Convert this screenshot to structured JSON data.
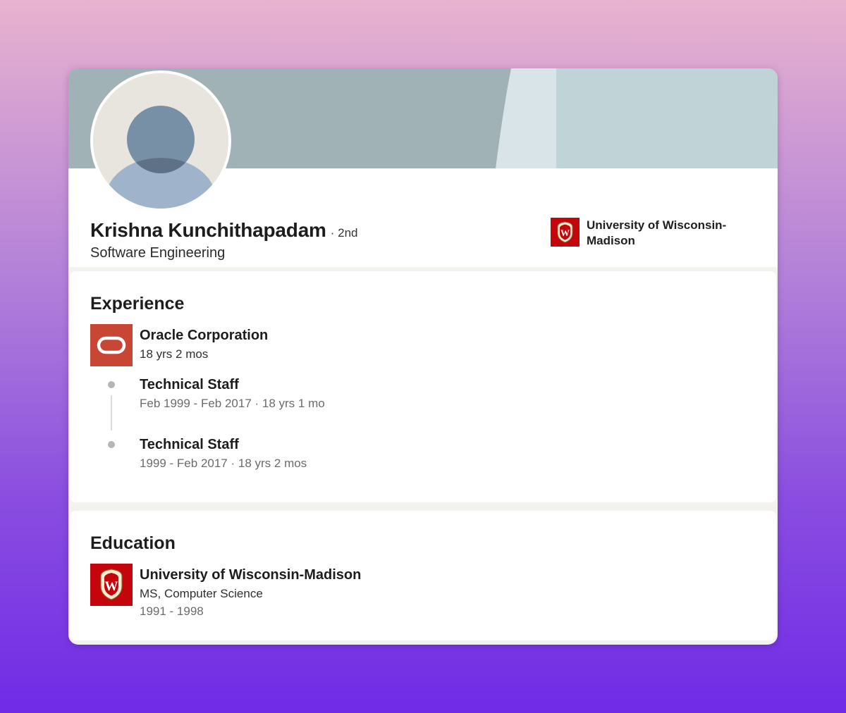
{
  "profile": {
    "name": "Krishna Kunchithapadam",
    "degree": "· 2nd",
    "headline": "Software Engineering",
    "top_school": "University of Wisconsin-Madison"
  },
  "experience": {
    "title": "Experience",
    "company": "Oracle Corporation",
    "company_duration": "18 yrs 2 mos",
    "roles": [
      {
        "title": "Technical Staff",
        "dates": "Feb 1999 - Feb 2017 · 18 yrs 1 mo"
      },
      {
        "title": "Technical Staff",
        "dates": "1999 - Feb 2017 · 18 yrs 2 mos"
      }
    ]
  },
  "education": {
    "title": "Education",
    "school": "University of Wisconsin-Madison",
    "degree": "MS, Computer Science",
    "years": "1991 - 1998"
  },
  "colors": {
    "oracle_red": "#c74634",
    "uw_red": "#c5050c",
    "banner_left": "#a0b2b6",
    "banner_right": "#c0d3d7"
  }
}
